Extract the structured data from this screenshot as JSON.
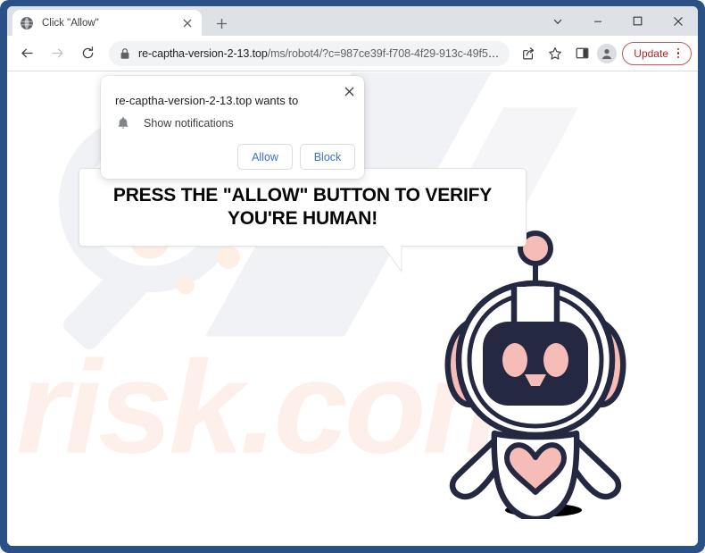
{
  "window": {
    "controls": [
      {
        "name": "chrome-menu-chevron",
        "icon": "chevron-down-icon"
      },
      {
        "name": "minimize",
        "icon": "minimize-icon"
      },
      {
        "name": "maximize",
        "icon": "maximize-icon"
      },
      {
        "name": "close",
        "icon": "close-icon"
      }
    ],
    "frame_color": "#2a5186"
  },
  "tab_strip": {
    "tab_title": "Click \"Allow\"",
    "favicon": "globe-icon",
    "close_icon": "close-icon",
    "new_tab_icon": "plus-icon"
  },
  "toolbar": {
    "back_icon": "arrow-left-icon",
    "forward_icon": "arrow-right-icon",
    "reload_icon": "reload-icon",
    "lock_icon": "lock-icon",
    "url_host": "re-captha-version-2-13.top",
    "url_path": "/ms/robot4/?c=987ce39f-f708-4f29-913c-49f5e...",
    "url_full": "re-captha-version-2-13.top/ms/robot4/?c=987ce39f-f708-4f29-913c-49f5e...",
    "share_icon": "share-icon",
    "bookmark_icon": "star-icon",
    "side_panel_icon": "side-panel-icon",
    "profile_icon": "person-avatar-icon",
    "update_label": "Update",
    "update_menu_icon": "three-dots-vertical-icon",
    "update_accent": "#b3261e"
  },
  "permission_dialog": {
    "title": "re-captha-version-2-13.top wants to",
    "option_icon": "bell-icon",
    "option_label": "Show notifications",
    "allow_label": "Allow",
    "block_label": "Block",
    "close_icon": "close-icon",
    "button_text_color": "#3b71cf"
  },
  "page": {
    "speech_bubble_text": "PRESS THE \"ALLOW\" BUTTON TO VERIFY\nYOU'RE HUMAN!",
    "mascot": "robot-mascot-illustration",
    "mascot_colors": {
      "outline": "#252841",
      "accent_pink": "#f6bdb8",
      "face_screen": "#252841",
      "body": "#ffffff"
    },
    "watermark_text_top": "pc",
    "watermark_text_bottom": "risk.com",
    "watermark_colors": {
      "gray": "#f1f2f5",
      "peach": "#fdf0ea"
    }
  }
}
